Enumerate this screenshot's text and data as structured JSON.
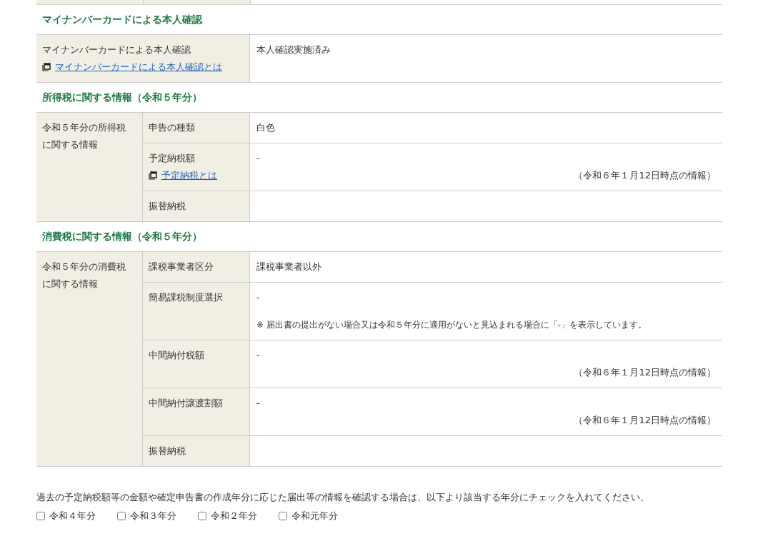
{
  "sections": [
    {
      "title": "マイナンバーカードによる本人確認",
      "kind": "single",
      "rows": [
        {
          "label": "マイナンバーカードによる本人確認",
          "link": "マイナンバーカードによる本人確認とは",
          "value": "本人確認実施済み"
        }
      ]
    },
    {
      "title": "所得税に関する情報（令和５年分）",
      "kind": "grouped",
      "group_label": "令和５年分の所得税に関する情報",
      "rows": [
        {
          "label": "申告の種類",
          "value": "白色"
        },
        {
          "label": "予定納税額",
          "link": "予定納税とは",
          "value": "-",
          "as_of": "（令和６年１月12日時点の情報）"
        },
        {
          "label": "振替納税"
        }
      ]
    },
    {
      "title": "消費税に関する情報（令和５年分）",
      "kind": "grouped",
      "group_label": "令和５年分の消費税に関する情報",
      "rows": [
        {
          "label": "課税事業者区分",
          "value": "課税事業者以外"
        },
        {
          "label": "簡易課税制度選択",
          "value": "-",
          "note": "※  届出書の提出がない場合又は令和５年分に適用がないと見込まれる場合に「-」を表示しています。"
        },
        {
          "label": "中間納付税額",
          "value": "-",
          "as_of": "（令和６年１月12日時点の情報）"
        },
        {
          "label": "中間納付譲渡割額",
          "value": "-",
          "as_of": "（令和６年１月12日時点の情報）"
        },
        {
          "label": "振替納税"
        }
      ]
    }
  ],
  "past_years": {
    "prompt": "過去の予定納税額等の金額や確定申告書の作成年分に応じた届出等の情報を確認する場合は、以下より該当する年分にチェックを入れてください。",
    "options": [
      {
        "label": "令和４年分",
        "checked": false
      },
      {
        "label": "令和３年分",
        "checked": false
      },
      {
        "label": "令和２年分",
        "checked": false
      },
      {
        "label": "令和元年分",
        "checked": false
      }
    ]
  }
}
